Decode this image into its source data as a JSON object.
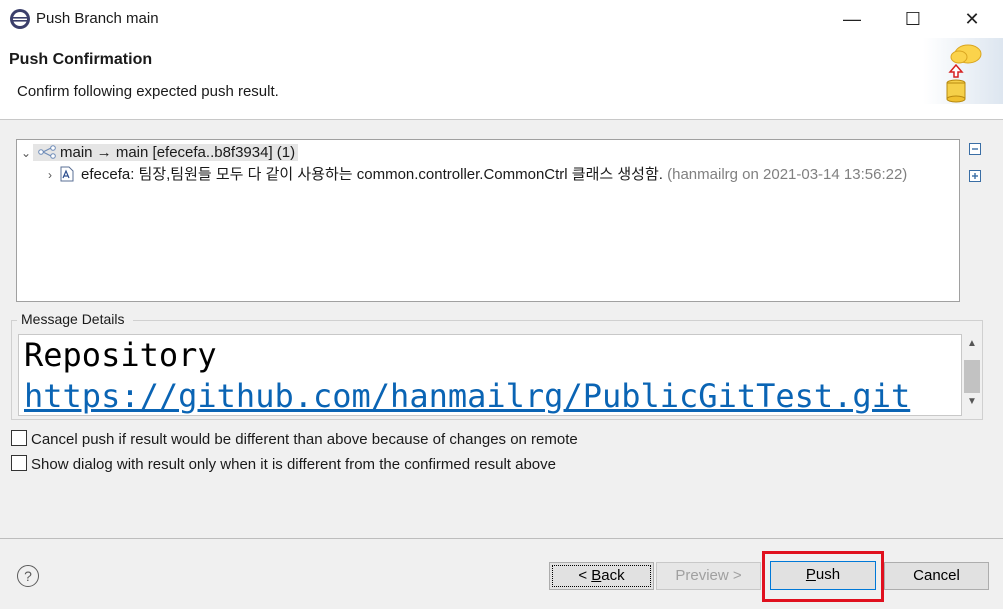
{
  "window": {
    "title": "Push Branch main",
    "minimize_icon": "minimize-icon",
    "maximize_icon": "maximize-icon",
    "close_icon": "close-icon"
  },
  "header": {
    "title": "Push Confirmation",
    "description": "Confirm following expected push result."
  },
  "tree": {
    "branch_row": {
      "label": "main → main [efecefa..b8f3934] (1)"
    },
    "commit_row": {
      "label": "efecefa: 팀장,팀원들 모두 다 같이 사용하는 common.controller.CommonCtrl 클래스 생성함.",
      "meta": "(hanmailrg on 2021-03-14 13:56:22)"
    }
  },
  "message_details": {
    "label": "Message Details",
    "line1": "Repository",
    "line2": "https://github.com/hanmailrg/PublicGitTest.git"
  },
  "options": {
    "cancel_if_different": "Cancel push if result would be different than above because of changes on remote",
    "show_only_if_different": "Show dialog with result only when it is different from the confirmed result above"
  },
  "buttons": {
    "back": {
      "prefix": "< ",
      "mnemonic": "B",
      "rest": "ack"
    },
    "preview": "Preview >",
    "push": {
      "mnemonic": "P",
      "rest": "ush"
    },
    "cancel": "Cancel"
  },
  "colors": {
    "highlight": "#e0101e",
    "link": "#0a64b4"
  }
}
